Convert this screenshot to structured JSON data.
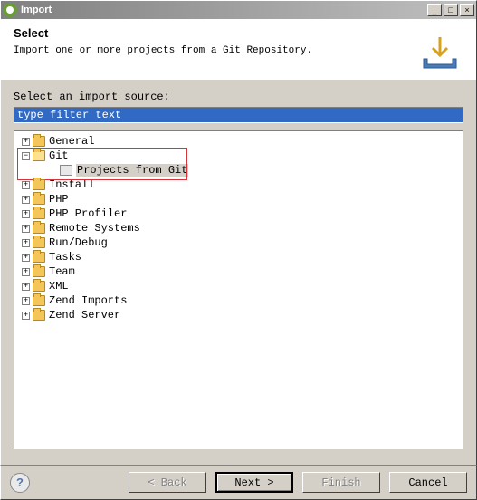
{
  "window": {
    "title": "Import"
  },
  "header": {
    "title": "Select",
    "description": "Import one or more projects from a Git Repository."
  },
  "body": {
    "source_label": "Select an import source:",
    "filter_value": "type filter text"
  },
  "tree": {
    "nodes": [
      {
        "label": "General",
        "expanded": false,
        "level": 1,
        "type": "folder"
      },
      {
        "label": "Git",
        "expanded": true,
        "level": 1,
        "type": "folder"
      },
      {
        "label": "Projects from Git",
        "level": 2,
        "type": "leaf",
        "selected": true
      },
      {
        "label": "Install",
        "expanded": false,
        "level": 1,
        "type": "folder"
      },
      {
        "label": "PHP",
        "expanded": false,
        "level": 1,
        "type": "folder"
      },
      {
        "label": "PHP Profiler",
        "expanded": false,
        "level": 1,
        "type": "folder"
      },
      {
        "label": "Remote Systems",
        "expanded": false,
        "level": 1,
        "type": "folder"
      },
      {
        "label": "Run/Debug",
        "expanded": false,
        "level": 1,
        "type": "folder"
      },
      {
        "label": "Tasks",
        "expanded": false,
        "level": 1,
        "type": "folder"
      },
      {
        "label": "Team",
        "expanded": false,
        "level": 1,
        "type": "folder"
      },
      {
        "label": "XML",
        "expanded": false,
        "level": 1,
        "type": "folder"
      },
      {
        "label": "Zend Imports",
        "expanded": false,
        "level": 1,
        "type": "folder"
      },
      {
        "label": "Zend Server",
        "expanded": false,
        "level": 1,
        "type": "folder"
      }
    ]
  },
  "buttons": {
    "back": "< Back",
    "next": "Next >",
    "finish": "Finish",
    "cancel": "Cancel"
  }
}
